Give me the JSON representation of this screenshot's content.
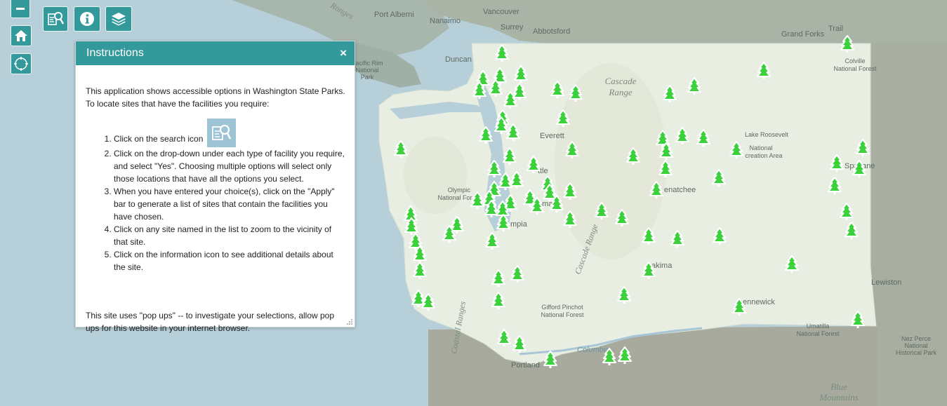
{
  "map": {
    "labels": {
      "port_alberni": "Port Alberni",
      "nanaimo": "Nanaimo",
      "vancouver": "Vancouver",
      "surrey": "Surrey",
      "abbotsford": "Abbotsford",
      "trail": "Trail",
      "grand_forks": "Grand Forks",
      "duncan": "Duncan",
      "colville": "Colville\nNational Forest",
      "cascade_range": "Cascade\nRange",
      "everett": "Everett",
      "lake_roosevelt": "Lake Roosevelt\nNational\ncreation Area",
      "spokane": "Spokane",
      "seattle": "ttle",
      "wenatchee": "enatchee",
      "olympic": "Olympic\nNational For",
      "tacoma": "oma",
      "olympia": "mpia",
      "cascade_range_2": "Cascade Range",
      "yakima": "akima",
      "lewiston": "Lewiston",
      "kennewick": "ennewick",
      "gifford": "Gifford Pinchot\nNational Forest",
      "coastal_ranges": "Coastal Ranges",
      "umatilla": "Umatilla\nNational Forest",
      "nez_perce": "Nez Perce\nNational\nHistorical Park",
      "portland": "Portland",
      "columbia": "Columbia",
      "blue_mountains": "Blue\nMountains",
      "ranges": "Ranges",
      "pacific_rim": "Pacific Rim\nNational\nPark"
    }
  },
  "toolbar": {
    "zoom_out": "zoom-out",
    "home": "home",
    "locate": "locate",
    "search": "search",
    "info": "info",
    "layers": "layers"
  },
  "instructions": {
    "title": "Instructions",
    "close": "×",
    "intro": "This application shows accessible options in Washington State Parks.  To locate sites that have the facilities you require:",
    "steps": [
      "Click on the search icon",
      "Click on the drop-down under each type of facility you require, and select \"Yes\".  Choosing multiple options will select only those locations that have all the options you select.",
      "When you have entered your choice(s), click on the \"Apply\" bar to generate a list of sites that contain the facilities you have chosen.",
      "Click on any site named in the list to zoom to the vicinity of that site.",
      "Click on the information icon to see additional details about the site."
    ],
    "note": "This site uses \"pop ups\" -- to investigate your selections, allow pop ups for this website in your internet browser."
  },
  "colors": {
    "accent": "#34999b",
    "tree": "#3bd13b",
    "water": "#b7cfd9",
    "land": "#e9eee2"
  }
}
